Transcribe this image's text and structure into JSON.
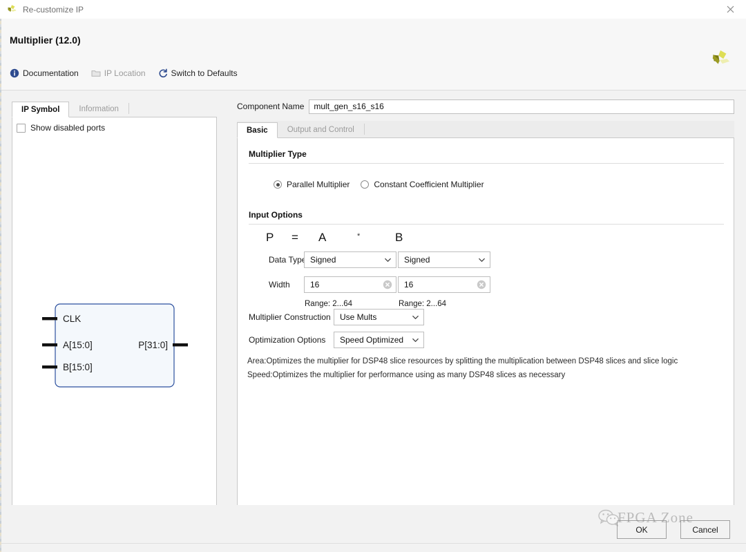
{
  "window": {
    "title": "Re-customize IP",
    "titlebar_icon": "xilinx-logo-icon",
    "close_icon": "close-icon"
  },
  "header": {
    "page_title": "Multiplier (12.0)",
    "brand_logo_icon": "xilinx-logo-icon",
    "toolbar": [
      {
        "label": "Documentation",
        "icon": "info-icon",
        "disabled": false
      },
      {
        "label": "IP Location",
        "icon": "folder-icon",
        "disabled": true
      },
      {
        "label": "Switch to Defaults",
        "icon": "refresh-icon",
        "disabled": false
      }
    ]
  },
  "left_panel": {
    "tabs": [
      {
        "label": "IP Symbol",
        "active": true
      },
      {
        "label": "Information",
        "active": false
      }
    ],
    "show_disabled_ports": {
      "label": "Show disabled ports",
      "checked": false
    },
    "symbol": {
      "inputs": [
        "CLK",
        "A[15:0]",
        "B[15:0]"
      ],
      "outputs": [
        "P[31:0]"
      ]
    }
  },
  "right_panel": {
    "component_name": {
      "label": "Component Name",
      "value": "mult_gen_s16_s16"
    },
    "tabs": [
      {
        "label": "Basic",
        "active": true
      },
      {
        "label": "Output and Control",
        "active": false
      }
    ],
    "multiplier_type": {
      "section_title": "Multiplier Type",
      "options": [
        {
          "label": "Parallel Multiplier",
          "selected": true
        },
        {
          "label": "Constant Coefficient Multiplier",
          "selected": false
        }
      ]
    },
    "input_options": {
      "section_title": "Input Options",
      "equation": {
        "p": "P",
        "eq": "=",
        "a": "A",
        "op": "*",
        "b": "B"
      },
      "data_type_label": "Data Type",
      "width_label": "Width",
      "port_a": {
        "data_type": "Signed",
        "width": "16",
        "range_note": "Range: 2...64"
      },
      "port_b": {
        "data_type": "Signed",
        "width": "16",
        "range_note": "Range: 2...64"
      }
    },
    "construction": {
      "label": "Multiplier Construction",
      "value": "Use Mults"
    },
    "optimization": {
      "label": "Optimization Options",
      "value": "Speed Optimized"
    },
    "descriptions": [
      "Area:Optimizes the multiplier for DSP48 slice resources by splitting the multiplication between DSP48 slices and slice logic",
      "Speed:Optimizes the multiplier for performance using as many DSP48 slices as necessary"
    ]
  },
  "footer": {
    "ok_label": "OK",
    "cancel_label": "Cancel"
  },
  "watermark": {
    "text": "FPGA Zone",
    "icon": "wechat-icon"
  },
  "colors": {
    "accent_blue": "#2e4b8f",
    "dialog_bg": "#f2f2f2",
    "panel_bg": "#ffffff",
    "border": "#c8c8c8",
    "symbol_border": "#2b4f9e",
    "brand_yellow": "#c8c832"
  }
}
